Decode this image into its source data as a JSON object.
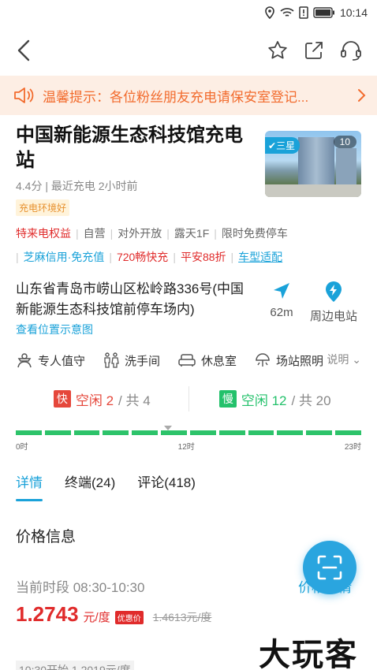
{
  "status_bar": {
    "time": "10:14"
  },
  "notice": {
    "text": "温馨提示：各位粉丝朋友充电请保安室登记..."
  },
  "station": {
    "title": "中国新能源生态科技馆充电站",
    "rating_meta": "4.4分 | 最近充电 2小时前",
    "env_tag": "充电环境好",
    "photo_badge": "三星",
    "photo_count": "10"
  },
  "tags_row1": [
    "特来电权益",
    "自营",
    "对外开放",
    "露天1F",
    "限时免费停车"
  ],
  "tags_row2": [
    "芝麻信用·免充值",
    "720畅快充",
    "平安88折",
    "车型适配"
  ],
  "address": {
    "text": "山东省青岛市崂山区松岭路336号(中国新能源生态科技馆前停车场内)",
    "map_link": "查看位置示意图",
    "distance": "62m",
    "nearby": "周边电站"
  },
  "facilities": {
    "items": [
      {
        "label": "专人值守",
        "icon": "staff-icon"
      },
      {
        "label": "洗手间",
        "icon": "restroom-icon"
      },
      {
        "label": "休息室",
        "icon": "lounge-icon"
      },
      {
        "label": "场站照明",
        "icon": "lighting-icon"
      }
    ],
    "explain": "说明"
  },
  "piles": {
    "fast_label": "快",
    "fast_idle": "空闲 2",
    "fast_total": " / 共 4",
    "slow_label": "慢",
    "slow_idle": "空闲 12",
    "slow_total": " / 共 20"
  },
  "timeline": {
    "ticks": [
      "0时",
      "12时",
      "23时"
    ],
    "segments": 12
  },
  "tabs": [
    "详情",
    "终端(24)",
    "评论(418)"
  ],
  "price": {
    "section_title": "价格信息",
    "period": "当前时段 08:30-10:30",
    "detail_link": "价格详情",
    "value": "1.2743",
    "unit": "元/度",
    "promo": "优惠价",
    "original": "1.4613元/度",
    "next": "10:30开始 1.2019元/度"
  },
  "watermark": "大玩客",
  "colors": {
    "accent": "#1aa2d9",
    "red": "#e02b2b",
    "green": "#23c16b",
    "notice_bg": "#fdeee4"
  }
}
